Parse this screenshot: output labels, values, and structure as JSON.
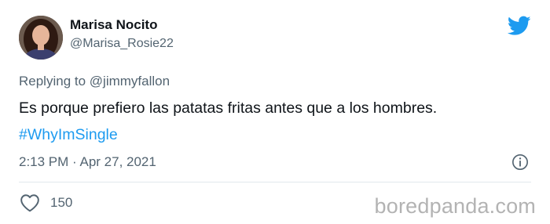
{
  "tweet": {
    "author_name": "Marisa Nocito",
    "author_handle": "@Marisa_Rosie22",
    "replying_to_prefix": "Replying to",
    "replying_to_handle": "@jimmyfallon",
    "text": "Es porque prefiero las patatas fritas antes que a los hombres.",
    "hashtag": "#WhyImSingle",
    "timestamp": "2:13 PM · Apr 27, 2021",
    "like_count": "150"
  },
  "icons": {
    "brand": "twitter-bird-icon",
    "info": "info-icon",
    "like": "heart-icon"
  },
  "watermark": "boredpanda.com",
  "colors": {
    "brand_blue": "#1d9bf0",
    "secondary_text": "#536471",
    "primary_text": "#0f1419"
  }
}
